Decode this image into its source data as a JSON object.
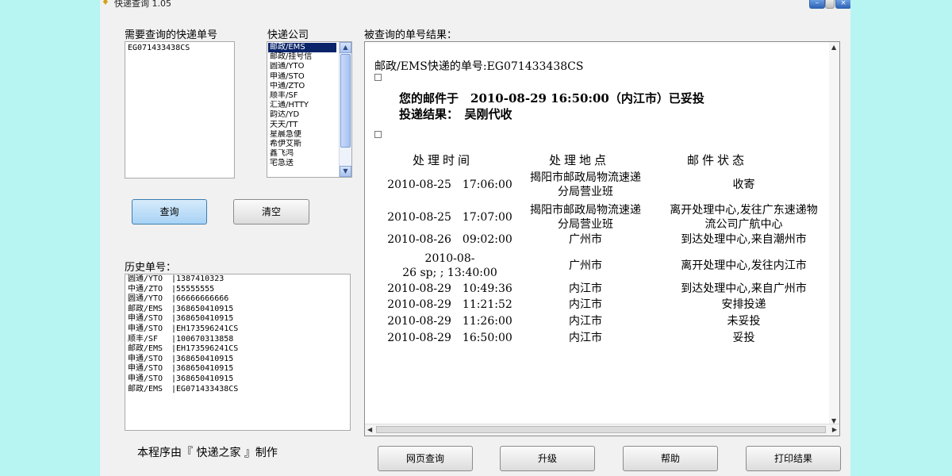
{
  "window": {
    "title": "快递查询 1.05"
  },
  "labels": {
    "tracking_input": "需要查询的快递单号",
    "company": "快递公司",
    "history": "历史单号：",
    "result": "被查询的单号结果："
  },
  "tracking_input": {
    "value": "EG071433438CS"
  },
  "companies": {
    "items": [
      "邮政/EMS",
      "邮政/挂号信",
      "圆通/YTO",
      "申通/STO",
      "中通/ZTO",
      "顺丰/SF",
      "汇通/HTTY",
      "韵达/YD",
      "天天/TT",
      "星晨急便",
      "希伊艾斯",
      "鑫飞鸿",
      "宅急送"
    ],
    "selected_index": 0
  },
  "buttons": {
    "query": "查询",
    "clear": "清空",
    "web_query": "网页查询",
    "upgrade": "升级",
    "help": "帮助",
    "print": "打印结果"
  },
  "history": [
    {
      "company": "圆通/YTO",
      "number": "1387410323"
    },
    {
      "company": "中通/ZTO",
      "number": "55555555"
    },
    {
      "company": "圆通/YTO",
      "number": "66666666666"
    },
    {
      "company": "邮政/EMS",
      "number": "368650410915"
    },
    {
      "company": "申通/STO",
      "number": "368650410915"
    },
    {
      "company": "申通/STO",
      "number": "EH173596241CS"
    },
    {
      "company": "顺丰/SF",
      "number": "100670313858"
    },
    {
      "company": "邮政/EMS",
      "number": "EH173596241CS"
    },
    {
      "company": "申通/STO",
      "number": "368650410915"
    },
    {
      "company": "申通/STO",
      "number": "368650410915"
    },
    {
      "company": "申通/STO",
      "number": "368650410915"
    },
    {
      "company": "邮政/EMS",
      "number": "EG071433438CS"
    }
  ],
  "footer_note": "本程序由『 快递之家 』制作",
  "result": {
    "heading": "邮政/EMS快递的单号:EG071433438CS",
    "notice_line1": "您的邮件于　2010-08-29 16:50:00（内江市）已妥投",
    "notice_line2": "投递结果：　吴刚代收",
    "columns": [
      "处理时间",
      "处理地点",
      "邮件状态"
    ],
    "rows": [
      {
        "time": [
          "2010-08-25　17:06:00"
        ],
        "place": [
          "揭阳市邮政局物流速递",
          "分局营业班"
        ],
        "status": [
          "收寄"
        ]
      },
      {
        "time": [
          "2010-08-25　17:07:00"
        ],
        "place": [
          "揭阳市邮政局物流速递",
          "分局营业班"
        ],
        "status": [
          "离开处理中心,发往广东速递物",
          "流公司广航中心"
        ]
      },
      {
        "time": [
          "2010-08-26　09:02:00"
        ],
        "place": [
          "广州市"
        ],
        "status": [
          "到达处理中心,来自潮州市"
        ]
      },
      {
        "time": [
          "2010-08-",
          "26 sp; ; 13:40:00"
        ],
        "place": [
          "广州市"
        ],
        "status": [
          "离开处理中心,发往内江市"
        ]
      },
      {
        "time": [
          "2010-08-29　10:49:36"
        ],
        "place": [
          "内江市"
        ],
        "status": [
          "到达处理中心,来自广州市"
        ]
      },
      {
        "time": [
          "2010-08-29　11:21:52"
        ],
        "place": [
          "内江市"
        ],
        "status": [
          "安排投递"
        ]
      },
      {
        "time": [
          "2010-08-29　11:26:00"
        ],
        "place": [
          "内江市"
        ],
        "status": [
          "未妥投"
        ]
      },
      {
        "time": [
          "2010-08-29　16:50:00"
        ],
        "place": [
          "内江市"
        ],
        "status": [
          "妥投"
        ]
      }
    ]
  },
  "colors": {
    "background": "#b7f5f3",
    "window": "#f1f1f1",
    "selection": "#0a246a",
    "primary_button": "#a8d2f5"
  }
}
